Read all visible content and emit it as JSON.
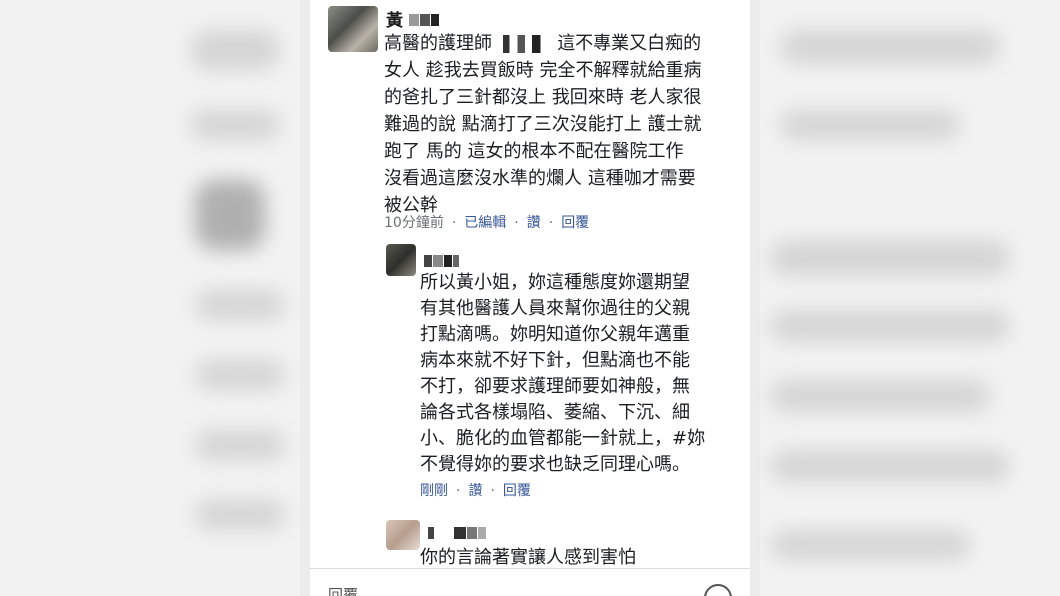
{
  "comments": [
    {
      "author": "黃",
      "text_lines": [
        "高醫的護理師",
        "這不專業又白痴的",
        "女人 趁我去買飯時 完全不解釋就給重病",
        "的爸扎了三針都沒上 我回來時 老人家很",
        "難過的說 點滴打了三次沒能打上 護士就",
        "跑了 馬的 這女的根本不配在醫院工作",
        "沒看過這麼沒水準的爛人 這種咖才需要",
        "被公幹"
      ],
      "time": "10分鐘前",
      "edited": "已編輯",
      "like": "讚",
      "reply": "回覆"
    },
    {
      "text_lines": [
        "所以黃小姐，妳這種態度妳還期望",
        "有其他醫護人員來幫你過往的父親",
        "打點滴嗎。妳明知道你父親年邁重",
        "病本來就不好下針，但點滴也不能",
        "不打，卻要求護理師要如神般，無",
        "論各式各樣塌陷、萎縮、下沉、細",
        "小、脆化的血管都能一針就上，#妳",
        "不覺得妳的要求也缺乏同理心嗎。"
      ],
      "time": "剛剛",
      "like": "讚",
      "reply": "回覆"
    },
    {
      "text_lines": [
        "你的言論著實讓人感到害怕"
      ]
    }
  ],
  "footer": {
    "reply_label": "回覆"
  }
}
